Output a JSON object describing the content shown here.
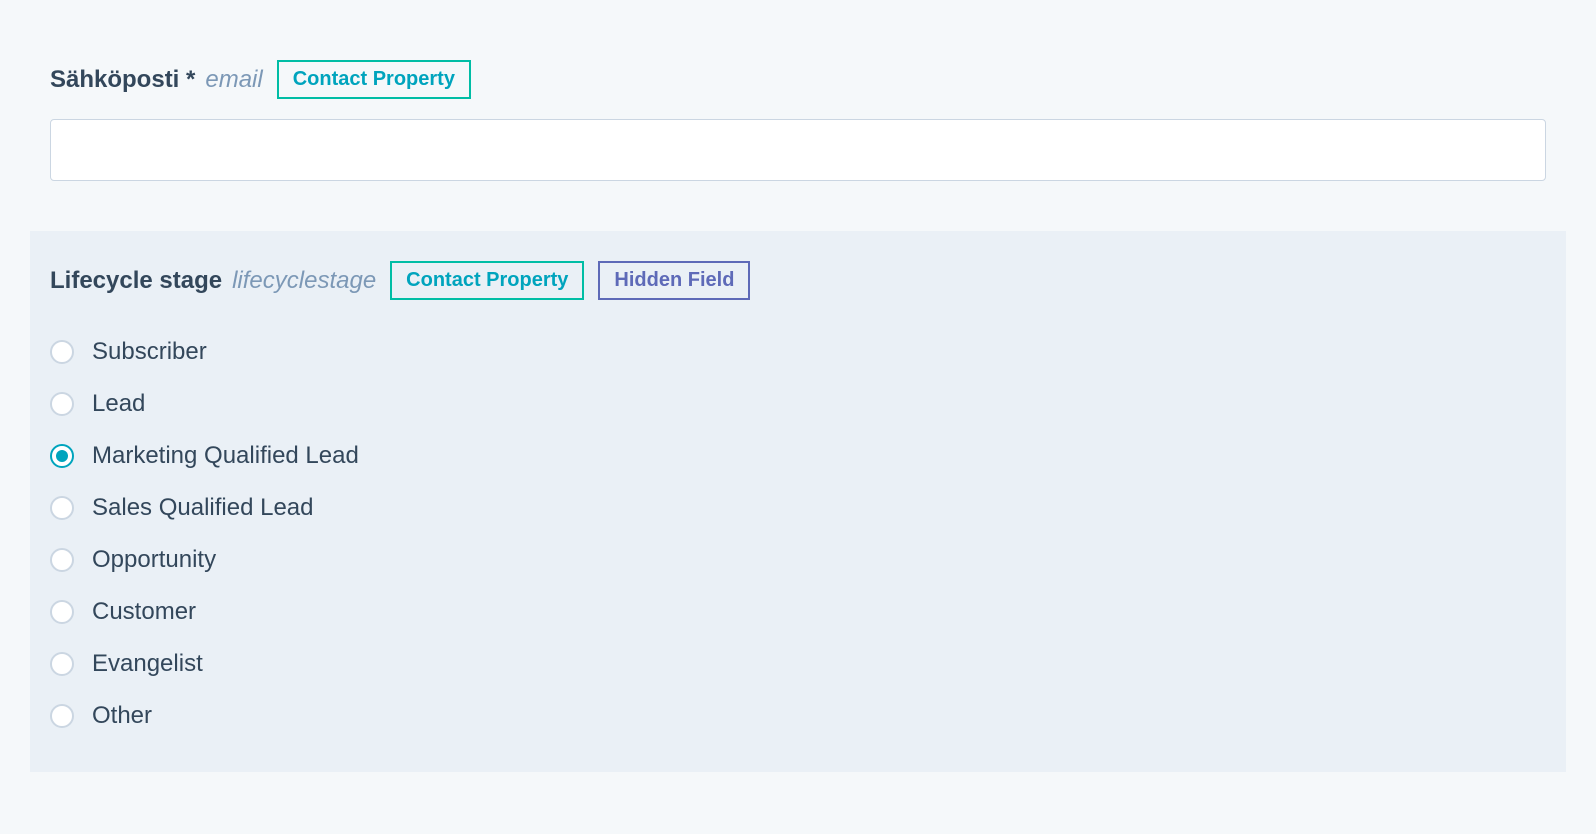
{
  "fields": {
    "email": {
      "label": "Sähköposti *",
      "internal_name": "email",
      "badges": [
        "Contact Property"
      ],
      "value": ""
    },
    "lifecycle": {
      "label": "Lifecycle stage",
      "internal_name": "lifecyclestage",
      "badges": [
        "Contact Property",
        "Hidden Field"
      ],
      "selected_index": 2,
      "options": [
        "Subscriber",
        "Lead",
        "Marketing Qualified Lead",
        "Sales Qualified Lead",
        "Opportunity",
        "Customer",
        "Evangelist",
        "Other"
      ]
    }
  }
}
